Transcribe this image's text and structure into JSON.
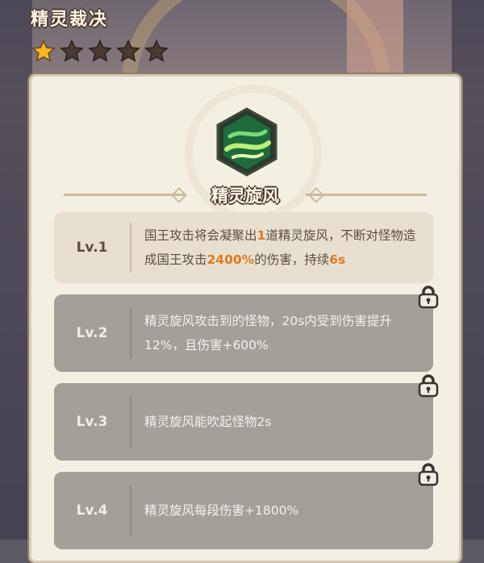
{
  "header": {
    "title": "精灵裁决",
    "stars_filled": 1,
    "stars_total": 5
  },
  "skill": {
    "name": "精灵旋风",
    "icon": "green-whirlwind-icon"
  },
  "levels": [
    {
      "label": "Lv.1",
      "locked": false,
      "desc_parts": [
        "国王攻击将会凝聚出",
        "1",
        "道精灵旋风，不断对怪物造成国王攻击",
        "2400%",
        "的伤害，持续",
        "6s"
      ]
    },
    {
      "label": "Lv.2",
      "locked": true,
      "desc": "精灵旋风攻击到的怪物，20s内受到伤害提升12%，且伤害+600%"
    },
    {
      "label": "Lv.3",
      "locked": true,
      "desc": "精灵旋风能吹起怪物2s"
    },
    {
      "label": "Lv.4",
      "locked": true,
      "desc": "精灵旋风每段伤害+1800%"
    }
  ],
  "colors": {
    "highlight": "#e07a1f",
    "star_filled": "#f5b62a",
    "star_empty": "#4a3b34"
  }
}
